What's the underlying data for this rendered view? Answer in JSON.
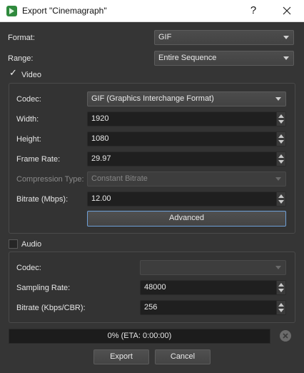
{
  "window": {
    "title": "Export \"Cinemagraph\"",
    "help_label": "?",
    "close_icon": "close-icon"
  },
  "format": {
    "label": "Format:",
    "value": "GIF"
  },
  "range": {
    "label": "Range:",
    "value": "Entire Sequence"
  },
  "video": {
    "checkbox_label": "Video",
    "checked": true,
    "codec": {
      "label": "Codec:",
      "value": "GIF (Graphics Interchange Format)"
    },
    "width": {
      "label": "Width:",
      "value": "1920"
    },
    "height": {
      "label": "Height:",
      "value": "1080"
    },
    "frame_rate": {
      "label": "Frame Rate:",
      "value": "29.97"
    },
    "compression": {
      "label": "Compression Type:",
      "value": "Constant Bitrate"
    },
    "bitrate": {
      "label": "Bitrate (Mbps):",
      "value": "12.00"
    },
    "advanced_label": "Advanced"
  },
  "audio": {
    "checkbox_label": "Audio",
    "checked": false,
    "codec": {
      "label": "Codec:",
      "value": ""
    },
    "sampling_rate": {
      "label": "Sampling Rate:",
      "value": "48000"
    },
    "bitrate": {
      "label": "Bitrate (Kbps/CBR):",
      "value": "256"
    }
  },
  "progress": {
    "text": "0% (ETA: 0:00:00)",
    "percent": 0
  },
  "buttons": {
    "export": "Export",
    "cancel": "Cancel"
  }
}
